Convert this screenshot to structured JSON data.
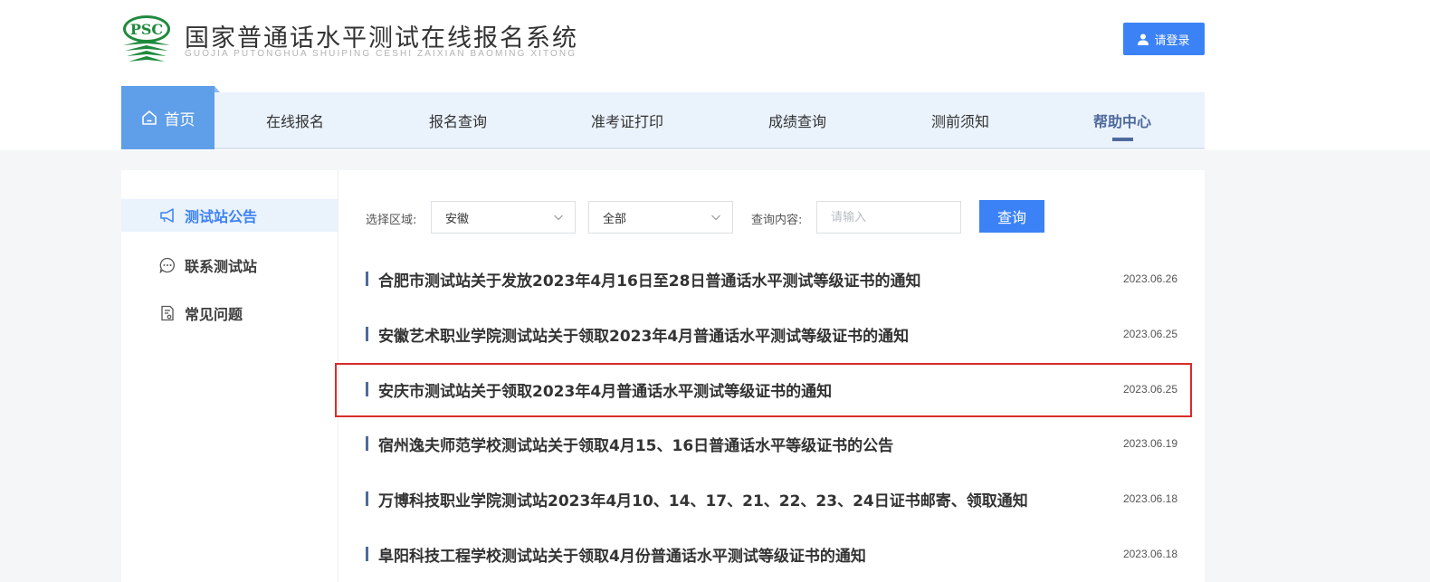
{
  "header": {
    "logo_text": "PSC",
    "title": "国家普通话水平测试在线报名系统",
    "subtitle": "GUOJIA PUTONGHUA SHUIPING CESHI ZAIXIAN BAOMING XITONG",
    "login_label": "请登录"
  },
  "nav": {
    "items": [
      {
        "label": "首页",
        "icon": "home-icon",
        "state": "current"
      },
      {
        "label": "在线报名"
      },
      {
        "label": "报名查询"
      },
      {
        "label": "准考证打印"
      },
      {
        "label": "成绩查询"
      },
      {
        "label": "测前须知"
      },
      {
        "label": "帮助中心",
        "state": "active"
      }
    ]
  },
  "sidebar": {
    "items": [
      {
        "label": "测试站公告",
        "icon": "megaphone-icon",
        "active": true
      },
      {
        "label": "联系测试站",
        "icon": "chat-bubble-icon"
      },
      {
        "label": "常见问题",
        "icon": "document-icon"
      }
    ]
  },
  "filter": {
    "region_label": "选择区域:",
    "region_value": "安徽",
    "scope_value": "全部",
    "query_label": "查询内容:",
    "query_placeholder": "请输入",
    "query_button": "查询"
  },
  "notices": [
    {
      "title": "合肥市测试站关于发放2023年4月16日至28日普通话水平测试等级证书的通知",
      "date": "2023.06.26"
    },
    {
      "title": "安徽艺术职业学院测试站关于领取2023年4月普通话水平测试等级证书的通知",
      "date": "2023.06.25"
    },
    {
      "title": "安庆市测试站关于领取2023年4月普通话水平测试等级证书的通知",
      "date": "2023.06.25",
      "highlighted": true
    },
    {
      "title": "宿州逸夫师范学校测试站关于领取4月15、16日普通话水平等级证书的公告",
      "date": "2023.06.19"
    },
    {
      "title": "万博科技职业学院测试站2023年4月10、14、17、21、22、23、24日证书邮寄、领取通知",
      "date": "2023.06.18"
    },
    {
      "title": "阜阳科技工程学校测试站关于领取4月份普通话水平测试等级证书的通知",
      "date": "2023.06.18"
    }
  ],
  "colors": {
    "primary": "#3b82f6",
    "nav_bg": "#eaf2fc",
    "home_tab": "#5f9ee8",
    "active_nav": "#4e6a9c",
    "highlight_border": "#d92b2b",
    "logo_green": "#1e8a3c"
  }
}
